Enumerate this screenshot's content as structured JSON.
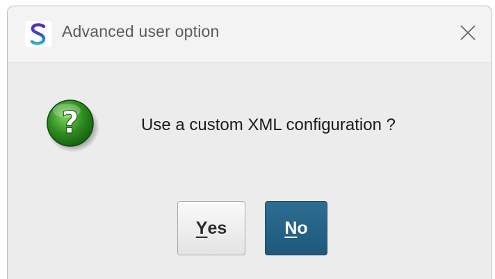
{
  "window": {
    "title": "Advanced user option",
    "app_icon": "app-s-logo-icon",
    "close_icon": "close-icon"
  },
  "dialog": {
    "icon": "question-icon",
    "message": "Use a custom XML configuration ?",
    "buttons": {
      "yes": {
        "mnemonic": "Y",
        "rest": "es"
      },
      "no": {
        "mnemonic": "N",
        "rest": "o"
      }
    }
  },
  "colors": {
    "primary_button": "#1e587a",
    "question_icon": "#2e8b1f",
    "app_icon_top": "#3b4cc0",
    "app_icon_bottom": "#2ab3c9"
  }
}
